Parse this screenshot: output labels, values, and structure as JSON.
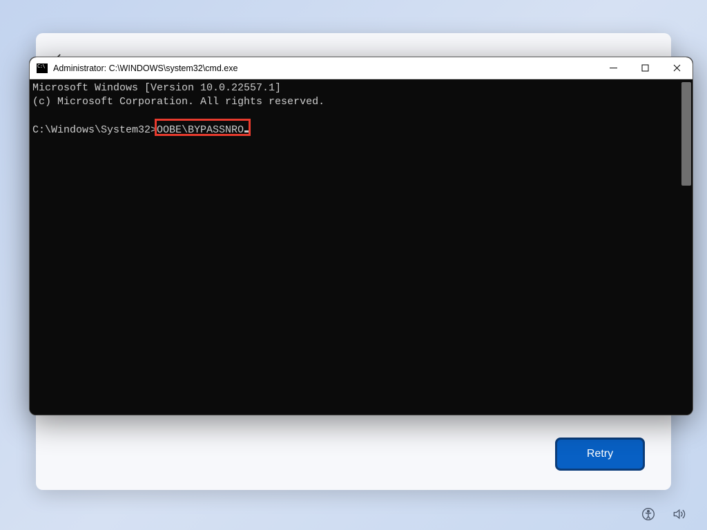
{
  "oobe": {
    "retry_label": "Retry"
  },
  "cmd": {
    "title": "Administrator: C:\\WINDOWS\\system32\\cmd.exe",
    "line1": "Microsoft Windows [Version 10.0.22557.1]",
    "line2": "(c) Microsoft Corporation. All rights reserved.",
    "prompt": "C:\\Windows\\System32>",
    "typed": "OOBE\\BYPASSNRO"
  },
  "highlight": {
    "color": "#e83b2e"
  }
}
